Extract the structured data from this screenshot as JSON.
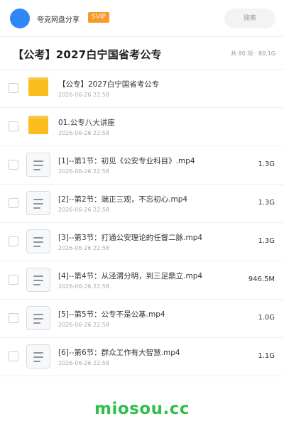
{
  "header": {
    "share_label": "夸克网盘分享",
    "vip_badge": "SVIP",
    "search_placeholder": "搜索"
  },
  "title": {
    "text": "【公考】2027白宁国省考公专",
    "meta": "共 80 项 · 80.1G"
  },
  "files": [
    {
      "type": "folder",
      "name": "【公专】2027白宁国省考公专",
      "date": "2026-06-26 22:58",
      "size": ""
    },
    {
      "type": "folder",
      "name": "01.公专八大讲座",
      "date": "2026-06-26 22:58",
      "size": ""
    },
    {
      "type": "video",
      "name": "[1]--第1节：初见《公安专业科目》.mp4",
      "date": "2026-06-26 22:58",
      "size": "1.3G"
    },
    {
      "type": "video",
      "name": "[2]--第2节：端正三观，不忘初心.mp4",
      "date": "2026-06-26 22:58",
      "size": "1.3G"
    },
    {
      "type": "video",
      "name": "[3]--第3节：打通公安理论的任督二脉.mp4",
      "date": "2026-06-26 22:58",
      "size": "1.3G"
    },
    {
      "type": "video",
      "name": "[4]--第4节：从泾渭分明，到三足鼎立.mp4",
      "date": "2026-06-26 22:58",
      "size": "946.5M"
    },
    {
      "type": "video",
      "name": "[5]--第5节：公专不是公基.mp4",
      "date": "2026-06-26 22:58",
      "size": "1.0G"
    },
    {
      "type": "video",
      "name": "[6]--第6节：群众工作有大智慧.mp4",
      "date": "2026-06-26 22:58",
      "size": "1.1G"
    }
  ],
  "watermark": "miosou.cc",
  "colors": {
    "avatar": "#2f86f6",
    "vip": "#f89a2a",
    "folder": "#fbbd1c",
    "watermark": "#2fbf4a"
  }
}
